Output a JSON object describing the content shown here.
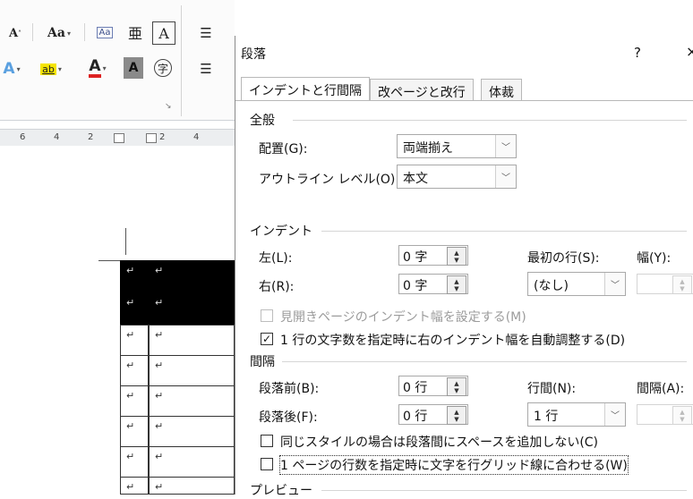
{
  "ribbon": {
    "font_grow": "A",
    "font_case": "Aa",
    "phonetic": "亜",
    "char_border": "A",
    "highlight": "ab",
    "font_color": "A",
    "char_shading": "A",
    "enclose_char": "字",
    "launcher": "↘"
  },
  "ruler": {
    "ticks": [
      "6",
      "4",
      "2",
      "2",
      "4"
    ]
  },
  "table": {
    "mark": "↵"
  },
  "dialog": {
    "title": "段落",
    "help": "?",
    "close": "×",
    "tabs": [
      {
        "label": "インデントと行間隔",
        "active": true
      },
      {
        "label": "改ページと改行",
        "active": false
      },
      {
        "label": "体裁",
        "active": false
      }
    ],
    "general": {
      "header": "全般",
      "alignment_label": "配置(G):",
      "alignment_value": "両端揃え",
      "outline_label": "アウトライン レベル(O):",
      "outline_value": "本文"
    },
    "indent": {
      "header": "インデント",
      "left_label": "左(L):",
      "left_value": "0 字",
      "right_label": "右(R):",
      "right_value": "0 字",
      "first_line_label": "最初の行(S):",
      "first_line_value": "(なし)",
      "width_label": "幅(Y):",
      "mirror_label": "見開きページのインデント幅を設定する(M)",
      "auto_adjust_label": "1 行の文字数を指定時に右のインデント幅を自動調整する(D)",
      "auto_adjust_checked": true,
      "mirror_checked": false
    },
    "spacing": {
      "header": "間隔",
      "before_label": "段落前(B):",
      "before_value": "0 行",
      "after_label": "段落後(F):",
      "after_value": "0 行",
      "line_spacing_label": "行間(N):",
      "line_spacing_value": "1 行",
      "at_label": "間隔(A):",
      "no_space_same_style_label": "同じスタイルの場合は段落間にスペースを追加しない(C)",
      "snap_to_grid_label": "1 ページの行数を指定時に文字を行グリッド線に合わせる(W)"
    },
    "preview": {
      "header": "プレビュー"
    }
  }
}
